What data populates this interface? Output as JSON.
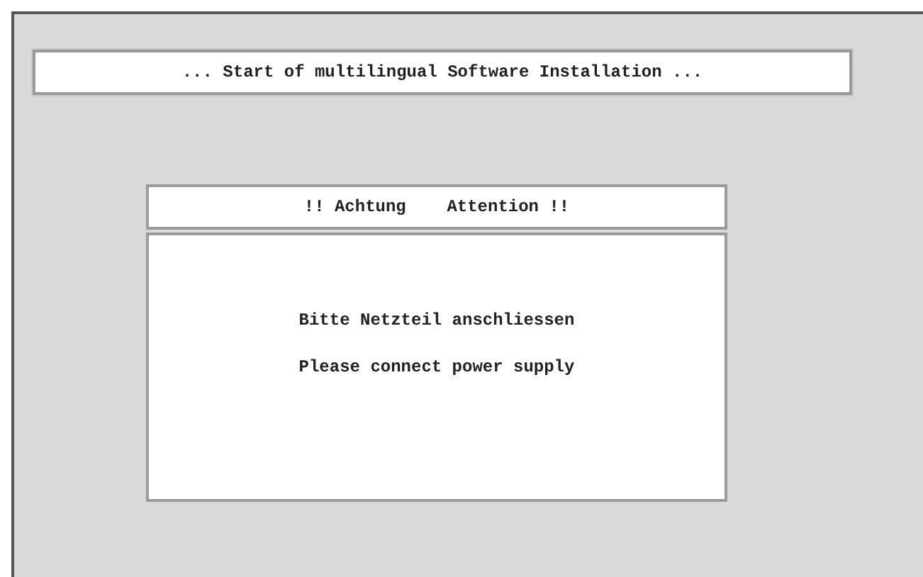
{
  "banner": {
    "text": "... Start of multilingual Software Installation ..."
  },
  "dialog": {
    "title": "!! Achtung    Attention !!",
    "messages": [
      "Bitte Netzteil anschliessen",
      "Please connect power supply"
    ]
  }
}
